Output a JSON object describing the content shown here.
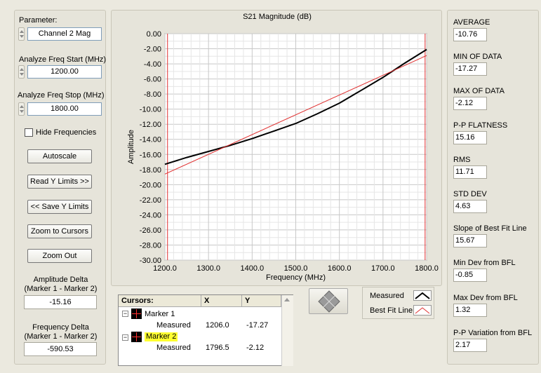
{
  "left": {
    "parameter_label": "Parameter:",
    "parameter_value": "Channel 2 Mag",
    "freq_start_label": "Analyze Freq Start (MHz)",
    "freq_start_value": "1200.00",
    "freq_stop_label": "Analyze Freq Stop (MHz)",
    "freq_stop_value": "1800.00",
    "hide_freq_label": "Hide Frequencies",
    "autoscale_label": "Autoscale",
    "read_limits_label": "Read Y Limits >>",
    "save_limits_label": "<< Save Y Limits",
    "zoom_cursors_label": "Zoom to Cursors",
    "zoom_out_label": "Zoom Out",
    "amp_delta_label_1": "Amplitude Delta",
    "amp_delta_label_2": "(Marker 1 - Marker 2)",
    "amp_delta_value": "-15.16",
    "freq_delta_label_1": "Frequency Delta",
    "freq_delta_label_2": "(Marker 1 - Marker 2)",
    "freq_delta_value": "-590.53"
  },
  "stats": [
    {
      "label": "AVERAGE",
      "value": "-10.76"
    },
    {
      "label": "MIN OF DATA",
      "value": "-17.27"
    },
    {
      "label": "MAX OF DATA",
      "value": "-2.12"
    },
    {
      "label": "P-P FLATNESS",
      "value": "15.16"
    },
    {
      "label": "RMS",
      "value": "11.71"
    },
    {
      "label": "STD DEV",
      "value": "4.63"
    },
    {
      "label": "Slope of Best Fit Line",
      "value": "15.67"
    },
    {
      "label": "Min Dev from BFL",
      "value": "-0.85"
    },
    {
      "label": "Max Dev from BFL",
      "value": "1.32"
    },
    {
      "label": "P-P Variation from BFL",
      "value": "2.17"
    }
  ],
  "chart_data": {
    "type": "line",
    "title": "S21 Magnitude (dB)",
    "xlabel": "Frequency (MHz)",
    "ylabel": "Amplitude",
    "xlim": [
      1200,
      1800
    ],
    "ylim": [
      -30,
      0
    ],
    "x_ticks": [
      "1200.0",
      "1300.0",
      "1400.0",
      "1500.0",
      "1600.0",
      "1700.0",
      "1800.0"
    ],
    "y_ticks": [
      "0.00",
      "-2.00",
      "-4.00",
      "-6.00",
      "-8.00",
      "-10.00",
      "-12.00",
      "-14.00",
      "-16.00",
      "-18.00",
      "-20.00",
      "-22.00",
      "-24.00",
      "-26.00",
      "-28.00",
      "-30.00"
    ],
    "grid": true,
    "series": [
      {
        "name": "Measured",
        "color": "#000000",
        "x": [
          1200,
          1250,
          1300,
          1350,
          1400,
          1450,
          1500,
          1550,
          1600,
          1650,
          1700,
          1750,
          1800
        ],
        "y": [
          -17.3,
          -16.4,
          -15.6,
          -14.8,
          -13.9,
          -12.9,
          -11.9,
          -10.6,
          -9.2,
          -7.5,
          -5.8,
          -3.9,
          -2.1
        ]
      },
      {
        "name": "Best Fit Line",
        "color": "#e03030",
        "x": [
          1200,
          1800
        ],
        "y": [
          -18.6,
          -2.9
        ]
      }
    ],
    "markers": [
      {
        "x": 1206,
        "color": "#e03030"
      },
      {
        "x": 1796.5,
        "color": "#e03030"
      }
    ]
  },
  "cursors": {
    "header": [
      "Cursors:",
      "X",
      "Y"
    ],
    "rows": [
      {
        "marker": "Marker 1",
        "sub": "Measured",
        "x": "1206.0",
        "y": "-17.27"
      },
      {
        "marker": "Marker 2",
        "sub": "Measured",
        "x": "1796.5",
        "y": "-2.12"
      }
    ]
  },
  "legend": [
    {
      "label": "Measured"
    },
    {
      "label": "Best Fit Line"
    }
  ]
}
